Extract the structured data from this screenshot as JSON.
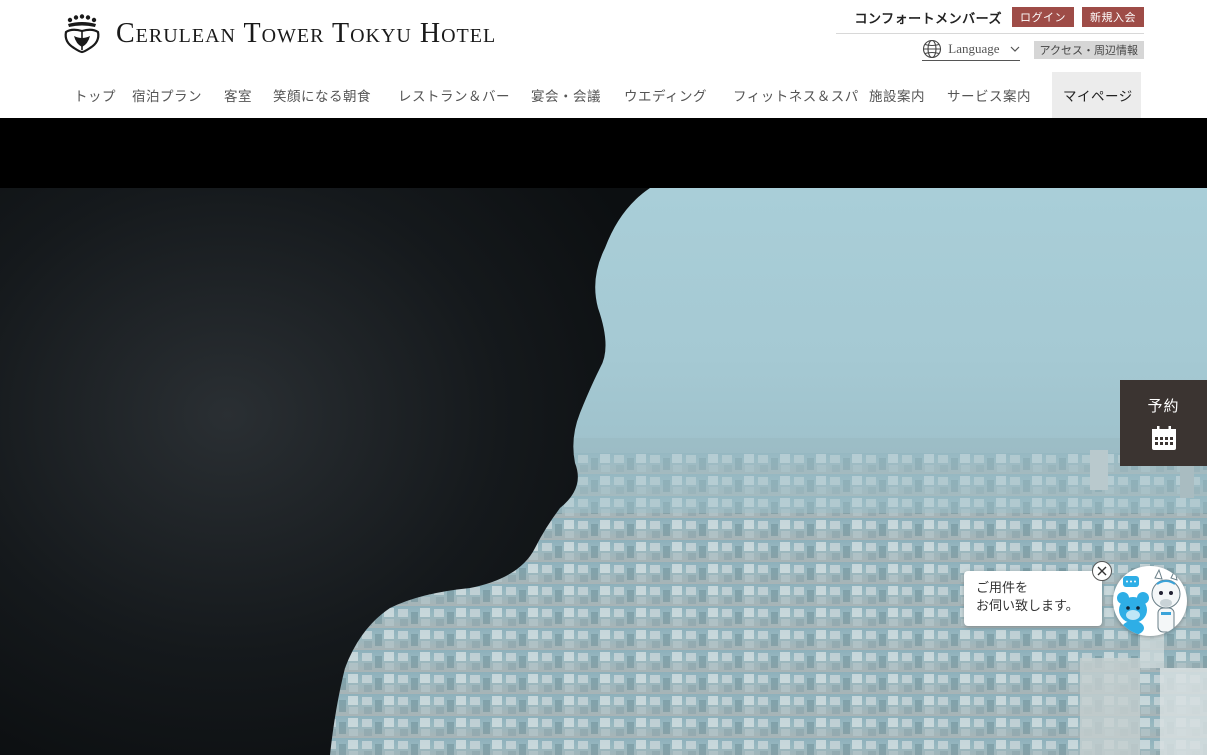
{
  "header": {
    "logo_text": "Cerulean Tower Tokyu Hotel",
    "logo_icon": "crest-icon",
    "member_label": "コンフォートメンバーズ",
    "login_label": "ログイン",
    "signup_label": "新規入会",
    "language_label": "Language",
    "access_label": "アクセス・周辺情報",
    "brand_color": "#9e4c47"
  },
  "nav": {
    "items": [
      {
        "label": "トップ"
      },
      {
        "label": "宿泊プラン"
      },
      {
        "label": "客室"
      },
      {
        "label": "笑顔になる朝食"
      },
      {
        "label": "レストラン＆バー"
      },
      {
        "label": "宴会・会議"
      },
      {
        "label": "ウエディング"
      },
      {
        "label": "フィットネス＆スパ"
      },
      {
        "label": "施設案内"
      },
      {
        "label": "サービス案内"
      },
      {
        "label": "マイページ",
        "active": true
      }
    ]
  },
  "reserve": {
    "label": "予約",
    "icon": "calendar-icon"
  },
  "chat": {
    "line1": "ご用件を",
    "line2": "お伺い致します。",
    "close_icon": "close-icon",
    "avatar_icon": "mascot-icon"
  }
}
